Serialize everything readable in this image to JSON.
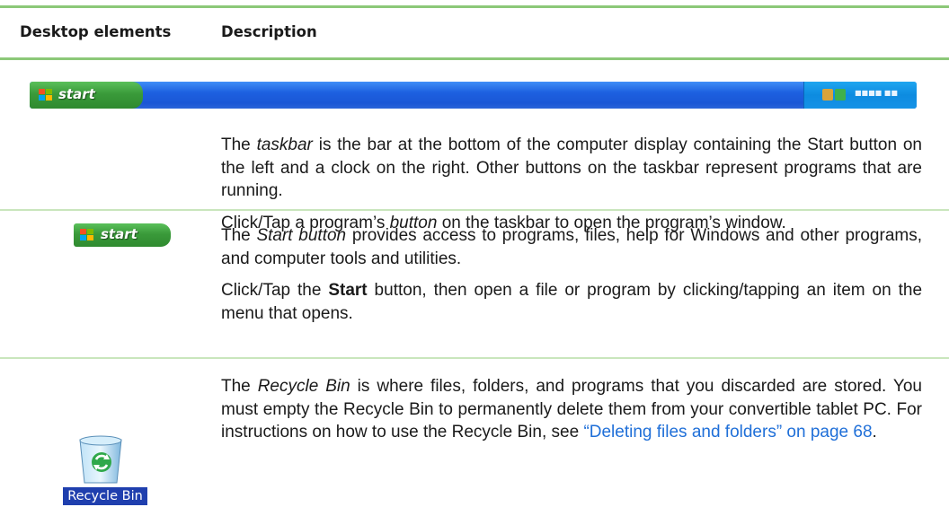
{
  "table": {
    "header": {
      "col1": "Desktop elements",
      "col2": "Description"
    },
    "rows": [
      {
        "name": "taskbar",
        "image_text": "start",
        "paragraphs": [
          {
            "pre": "The ",
            "em": "taskbar",
            "post": " is the bar at the bottom of the computer display containing the Start button on the left and a clock on the right. Other buttons on the taskbar represent programs that are running."
          },
          {
            "pre": "Click/Tap a program’s ",
            "em": "button",
            "post": " on the taskbar to open the program’s window."
          }
        ]
      },
      {
        "name": "start-button",
        "image_text": "start",
        "paragraphs": [
          {
            "pre": "The ",
            "em": "Start button",
            "post": " provides access to programs, files, help for Windows and other programs, and computer tools and utilities."
          },
          {
            "pre": "Click/Tap the ",
            "strong": "Start",
            "post": " button, then open a file or program by clicking/tapping an item on the menu that opens."
          }
        ]
      },
      {
        "name": "recycle-bin",
        "image_text": "Recycle Bin",
        "paragraphs": [
          {
            "pre": "The ",
            "em": "Recycle Bin",
            "post": " is where files, folders, and programs that you discarded are stored. You must empty the Recycle Bin to permanently delete them from your convertible tablet PC. For instructions on how to use the Recycle Bin, see ",
            "link": "“Deleting files and folders” on page 68",
            "tail": "."
          }
        ]
      }
    ]
  },
  "colors": {
    "rule": "#8cc878",
    "link": "#1f6fd8",
    "taskbar_blue": "#1d60e0",
    "start_green": "#3a9a3a"
  }
}
